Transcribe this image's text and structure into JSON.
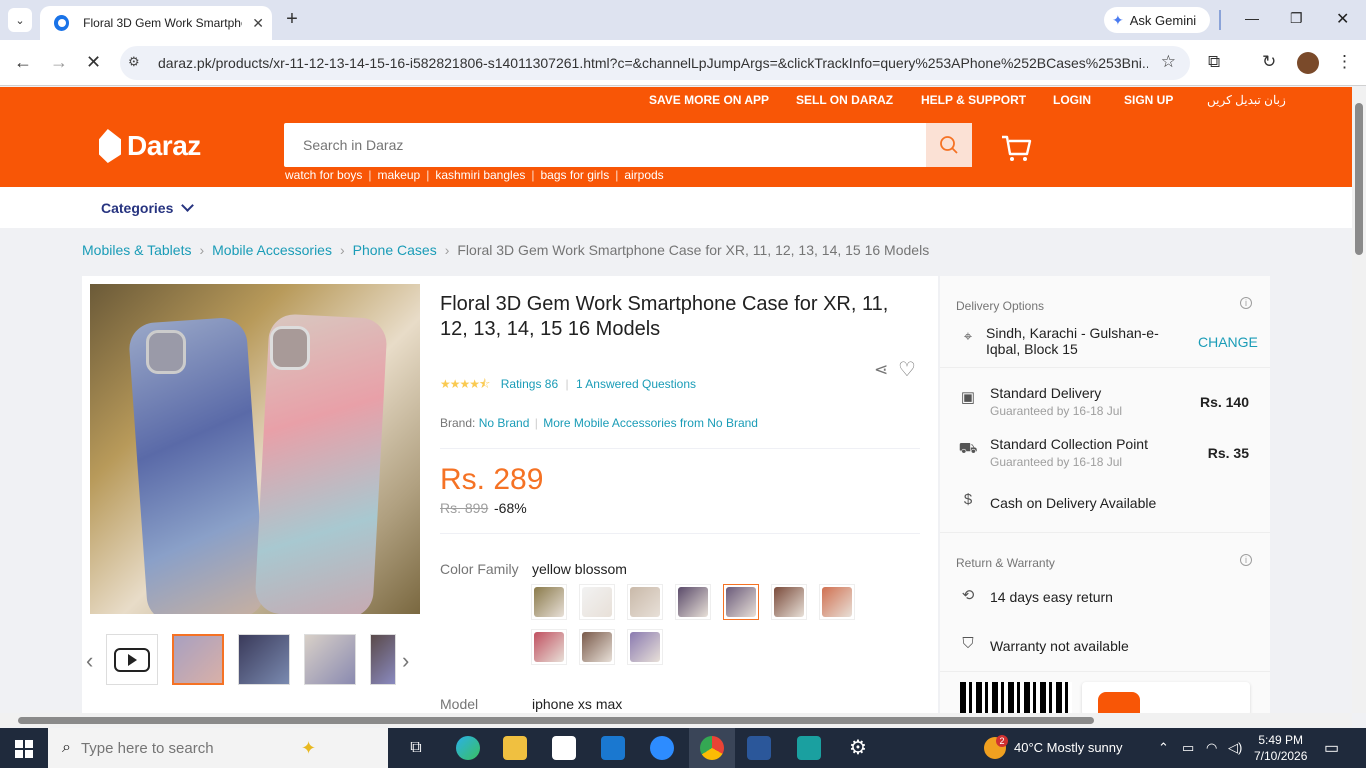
{
  "browser": {
    "tab_title": "Floral 3D Gem Work Smartphon",
    "new_tab": "+",
    "gemini": "Ask Gemini",
    "url": "daraz.pk/products/xr-11-12-13-14-15-16-i582821806-s14011307261.html?c=&channelLpJumpArgs=&clickTrackInfo=query%253APhone%252BCases%253Bni..."
  },
  "header": {
    "top_links": [
      "SAVE MORE ON APP",
      "SELL ON DARAZ",
      "HELP & SUPPORT",
      "LOGIN",
      "SIGN UP",
      "زبان تبدیل کریں"
    ],
    "logo_text": "Daraz",
    "search_placeholder": "Search in Daraz",
    "suggestions": [
      "watch for boys",
      "makeup",
      "kashmiri bangles",
      "bags for girls",
      "airpods"
    ],
    "categories_label": "Categories"
  },
  "breadcrumb": [
    "Mobiles & Tablets",
    "Mobile Accessories",
    "Phone Cases",
    "Floral 3D Gem Work Smartphone Case for XR, 11, 12, 13, 14, 15 16 Models"
  ],
  "product": {
    "title": "Floral 3D Gem Work Smartphone Case for XR, 11, 12, 13, 14, 15 16 Models",
    "rating_value": 4.5,
    "ratings_label": "Ratings 86",
    "answered_questions": "1 Answered Questions",
    "brand_label": "Brand:",
    "brand": "No Brand",
    "more_from": "More Mobile Accessories from No Brand",
    "price": "Rs. 289",
    "old_price": "Rs. 899",
    "discount": "-68%",
    "color_family_label": "Color Family",
    "color_family_value": "yellow blossom",
    "model_label": "Model",
    "model_value": "iphone xs max",
    "swatches": [
      {
        "name": "swatch-1",
        "color": "#8a7a4a"
      },
      {
        "name": "swatch-2",
        "color": "#f2f2f2"
      },
      {
        "name": "swatch-3",
        "color": "#c9b9a9"
      },
      {
        "name": "swatch-4",
        "color": "#5a4a6a"
      },
      {
        "name": "swatch-5",
        "color": "#6a5a7a"
      },
      {
        "name": "swatch-6",
        "color": "#7a4a3a"
      },
      {
        "name": "swatch-7",
        "color": "#d07050"
      },
      {
        "name": "swatch-8",
        "color": "#c05060"
      },
      {
        "name": "swatch-9",
        "color": "#7a5a4a"
      },
      {
        "name": "swatch-10",
        "color": "#8a7ab0"
      }
    ],
    "selected_swatch_index": 4
  },
  "delivery": {
    "heading": "Delivery Options",
    "location": "Sindh, Karachi - Gulshan-e-Iqbal, Block 15",
    "change": "CHANGE",
    "standard_title": "Standard Delivery",
    "standard_sub": "Guaranteed by 16-18 Jul",
    "standard_price": "Rs. 140",
    "collection_title": "Standard Collection Point",
    "collection_sub": "Guaranteed by 16-18 Jul",
    "collection_price": "Rs. 35",
    "cod": "Cash on Delivery Available"
  },
  "warranty": {
    "heading": "Return & Warranty",
    "return": "14 days easy return",
    "warranty": "Warranty not available"
  },
  "taskbar": {
    "search_placeholder": "Type here to search",
    "weather": "40°C  Mostly sunny",
    "time": "5:49 PM",
    "date": "7/10/2026",
    "badge": "2"
  },
  "colors": {
    "daraz_orange": "#f85606",
    "price_orange": "#f57224",
    "link_teal": "#1a9cb7"
  }
}
